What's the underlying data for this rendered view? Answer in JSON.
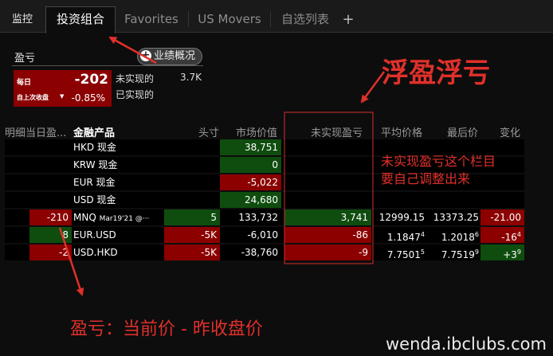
{
  "tabs": {
    "monitor": "监控",
    "portfolio": "投资组合",
    "favorites": "Favorites",
    "us_movers": "US Movers",
    "watchlist": "自选列表",
    "add": "+"
  },
  "pnl": {
    "title": "盈亏",
    "perf_button": "业绩概况",
    "daily_label": "每日",
    "daily_value": "-202",
    "since_close_label": "自上次收盘",
    "since_close_pct": "-0.85%",
    "unrealized_label": "未实现的",
    "unrealized_value": "3.7K",
    "realized_label": "已实现的"
  },
  "table": {
    "headers": [
      "明细当日盈...",
      "金融产品",
      "头寸",
      "市场价值",
      "未实现盈亏",
      "平均价格",
      "最后价",
      "变化"
    ],
    "rows": [
      {
        "daily": "",
        "instrument": "HKD 现金",
        "position": "",
        "market_value": "38,751",
        "unrealized": "",
        "avg_price": "",
        "avg_sup": "",
        "last": "",
        "last_sup": "",
        "change": "",
        "change_sup": ""
      },
      {
        "daily": "",
        "instrument": "KRW 现金",
        "position": "",
        "market_value": "0",
        "unrealized": "",
        "avg_price": "",
        "avg_sup": "",
        "last": "",
        "last_sup": "",
        "change": "",
        "change_sup": ""
      },
      {
        "daily": "",
        "instrument": "EUR 现金",
        "position": "",
        "market_value": "-5,022",
        "unrealized": "",
        "avg_price": "",
        "avg_sup": "",
        "last": "",
        "last_sup": "",
        "change": "",
        "change_sup": ""
      },
      {
        "daily": "",
        "instrument": "USD 现金",
        "position": "",
        "market_value": "24,680",
        "unrealized": "",
        "avg_price": "",
        "avg_sup": "",
        "last": "",
        "last_sup": "",
        "change": "",
        "change_sup": ""
      },
      {
        "daily": "-210",
        "instrument": "MNQ",
        "instrument_detail": "Mar19'21 @···",
        "position": "5",
        "market_value": "133,732",
        "unrealized": "3,741",
        "avg_price": "12999.15",
        "avg_sup": "",
        "last": "13373.25",
        "last_sup": "",
        "change": "-21.00",
        "change_sup": ""
      },
      {
        "daily": "8",
        "instrument": "EUR.USD",
        "position": "-5K",
        "market_value": "-6,010",
        "unrealized": "-86",
        "avg_price": "1.1847",
        "avg_sup": "4",
        "last": "1.2018",
        "last_sup": "6",
        "change": "-16",
        "change_sup": "4"
      },
      {
        "daily": "-2",
        "instrument": "USD.HKD",
        "position": "-5K",
        "market_value": "-38,760",
        "unrealized": "-9",
        "avg_price": "7.7501",
        "avg_sup": "5",
        "last": "7.7519",
        "last_sup": "9",
        "change": "+3",
        "change_sup": "9"
      }
    ]
  },
  "annotations": {
    "floating_pnl": "浮盈浮亏",
    "unrealized_note_line1": "未实现盈亏这个栏目",
    "unrealized_note_line2": "要自己调整出来",
    "pnl_formula": "盈亏：当前价 - 昨收盘价",
    "watermark": "wenda.ibclubs.com"
  },
  "colors": {
    "gain_box": "#0f4d0f",
    "loss_box": "#8c0000",
    "annotation": "#e0302a"
  }
}
